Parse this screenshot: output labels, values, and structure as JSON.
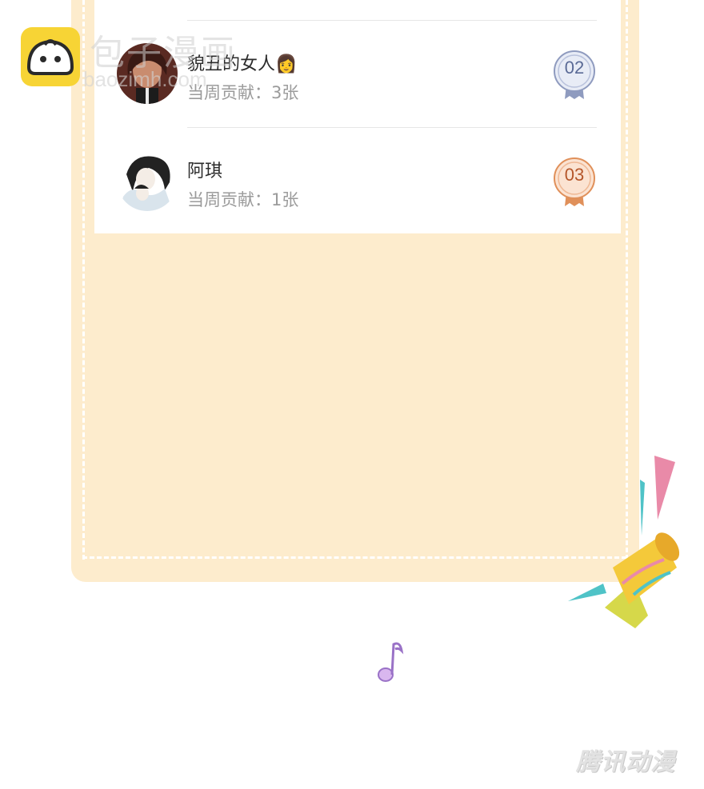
{
  "watermark": {
    "brand_cn": "包子漫画",
    "brand_url": "baozimh.com",
    "corner_text": "腾讯动漫"
  },
  "ranking": {
    "entries": [
      {
        "name": "貌丑的女人👩",
        "contribution": "当周贡献：3张",
        "rank": "02",
        "badge_color": "#8f9bbf"
      },
      {
        "name": "阿琪",
        "contribution": "当周贡献：1张",
        "rank": "03",
        "badge_color": "#e0905a"
      }
    ]
  },
  "colors": {
    "card_background": "#fdeccd",
    "logo_yellow": "#f7d435",
    "silver_badge": "#8f9bbf",
    "bronze_badge": "#e0905a"
  },
  "icons": [
    "baozi-logo-icon",
    "silver-medal-icon",
    "bronze-medal-icon",
    "party-popper-icon",
    "music-note-icon"
  ]
}
